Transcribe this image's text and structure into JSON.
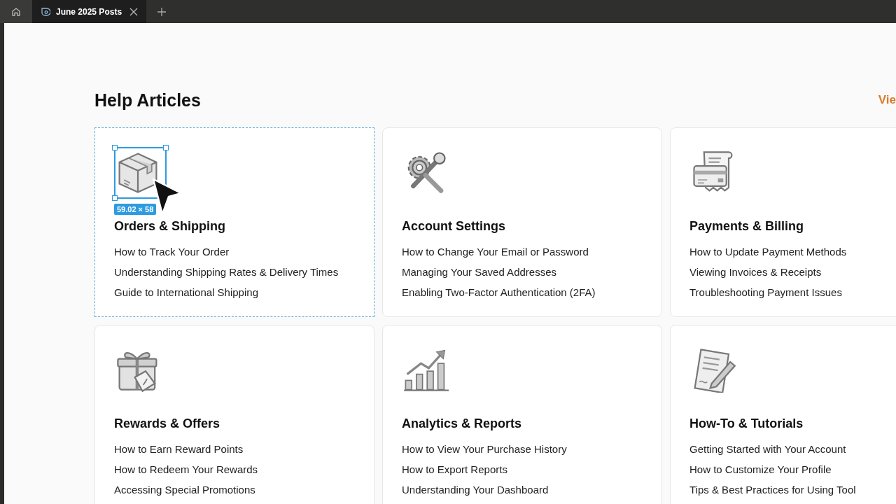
{
  "browser": {
    "tab_title": "June 2025 Posts"
  },
  "header": {
    "title": "Help Articles",
    "link": "Vie"
  },
  "selection_label": "59.02 × 58",
  "cards": [
    {
      "kind": "box",
      "selected": true,
      "title": "Orders & Shipping",
      "links": [
        "How to Track Your Order",
        "Understanding Shipping Rates & Delivery Times",
        "Guide to International Shipping"
      ]
    },
    {
      "kind": "tools",
      "selected": false,
      "title": "Account Settings",
      "links": [
        "How to Change Your Email or Password",
        "Managing Your Saved Addresses",
        "Enabling Two-Factor Authentication (2FA)"
      ]
    },
    {
      "kind": "receipt",
      "selected": false,
      "title": "Payments & Billing",
      "links": [
        "How to Update Payment Methods",
        "Viewing Invoices & Receipts",
        "Troubleshooting Payment Issues"
      ]
    },
    {
      "kind": "gift",
      "selected": false,
      "title": "Rewards & Offers",
      "links": [
        "How to Earn Reward Points",
        "How to Redeem Your Rewards",
        "Accessing Special Promotions"
      ]
    },
    {
      "kind": "chart",
      "selected": false,
      "title": "Analytics & Reports",
      "links": [
        "How to View Your Purchase History",
        "How to Export Reports",
        "Understanding Your Dashboard"
      ]
    },
    {
      "kind": "document",
      "selected": false,
      "title": "How-To & Tutorials",
      "links": [
        "Getting Started with Your Account",
        "How to Customize Your Profile",
        "Tips & Best Practices for Using Tool"
      ]
    }
  ]
}
